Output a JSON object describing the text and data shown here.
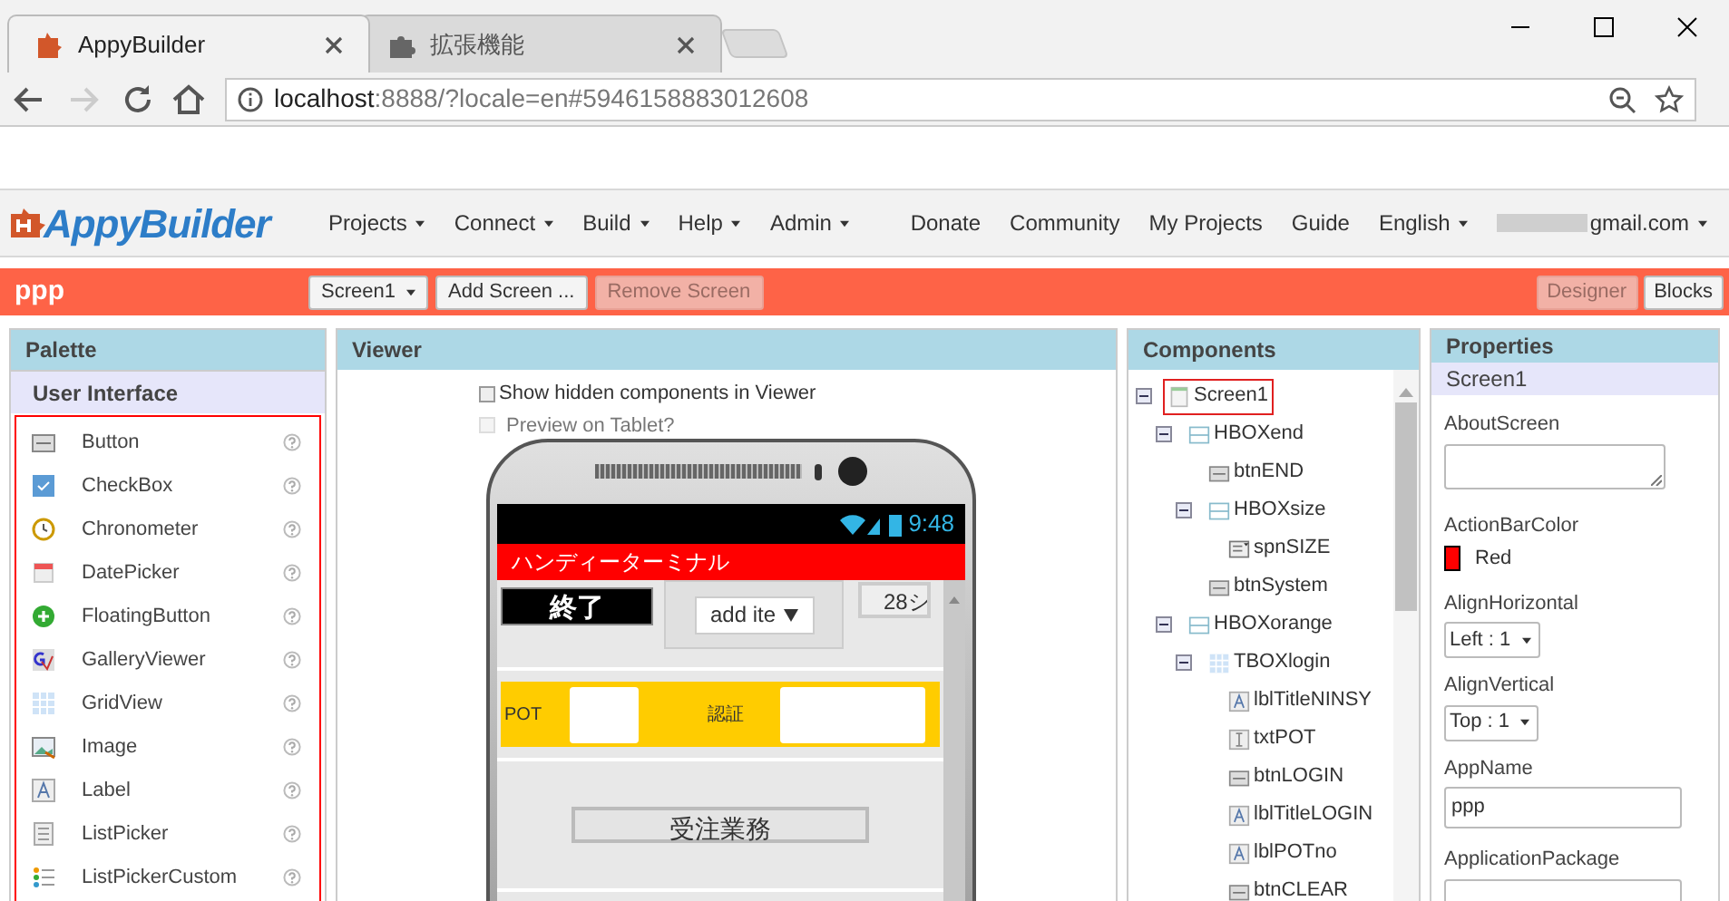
{
  "browser": {
    "tabs": [
      {
        "title": "AppyBuilder",
        "selected": true,
        "kind": "app"
      },
      {
        "title": "拡張機能",
        "selected": false,
        "kind": "puzzle"
      }
    ],
    "url": {
      "host": "localhost",
      "rest": ":8888/?locale=en#5946158883012608"
    }
  },
  "nav": {
    "logo": "AppyBuilder",
    "menus": [
      {
        "label": "Projects",
        "dropdown": true
      },
      {
        "label": "Connect",
        "dropdown": true
      },
      {
        "label": "Build",
        "dropdown": true
      },
      {
        "label": "Help",
        "dropdown": true
      },
      {
        "label": "Admin",
        "dropdown": true
      }
    ],
    "right_menus": [
      {
        "label": "Donate",
        "dropdown": false
      },
      {
        "label": "Community",
        "dropdown": false
      },
      {
        "label": "My Projects",
        "dropdown": false
      },
      {
        "label": "Guide",
        "dropdown": false
      },
      {
        "label": "English",
        "dropdown": true
      },
      {
        "label": "gmail.com",
        "dropdown": true
      }
    ]
  },
  "toolbar": {
    "project": "ppp",
    "buttons": [
      {
        "label": "Screen1",
        "dropdown": true,
        "disabled": false
      },
      {
        "label": "Add Screen ...",
        "dropdown": false,
        "disabled": false
      },
      {
        "label": "Remove Screen",
        "dropdown": false,
        "disabled": true
      }
    ],
    "views": [
      {
        "label": "Designer",
        "selected": true
      },
      {
        "label": "Blocks",
        "selected": false
      }
    ]
  },
  "palette": {
    "title": "Palette",
    "section": "User Interface",
    "items": [
      "Button",
      "CheckBox",
      "Chronometer",
      "DatePicker",
      "FloatingButton",
      "GalleryViewer",
      "GridView",
      "Image",
      "Label",
      "ListPicker",
      "ListPickerCustom"
    ]
  },
  "viewer": {
    "title": "Viewer",
    "options": [
      {
        "label": "Show hidden components in Viewer",
        "checked": false,
        "disabled": false
      },
      {
        "label": "Preview on Tablet?",
        "checked": false,
        "disabled": true
      }
    ],
    "phone": {
      "time": "9:48",
      "title": "ハンディーターミナル",
      "end_button": "終了",
      "spinner": "add ite",
      "cut_button": "28シ",
      "pot_label": "POT",
      "auth_label": "認証",
      "order_button": "受注業務"
    }
  },
  "components": {
    "title": "Components",
    "tree": [
      {
        "name": "Screen1",
        "kind": "screen",
        "selected": true,
        "expanded": true,
        "children": [
          {
            "name": "HBOXend",
            "kind": "hbox",
            "selected": false,
            "expanded": true,
            "children": [
              {
                "name": "btnEND",
                "kind": "button",
                "selected": false
              },
              {
                "name": "HBOXsize",
                "kind": "hbox",
                "selected": false,
                "expanded": true,
                "children": [
                  {
                    "name": "spnSIZE",
                    "kind": "spinner",
                    "selected": false
                  }
                ]
              },
              {
                "name": "btnSystem",
                "kind": "button",
                "selected": false
              }
            ]
          },
          {
            "name": "HBOXorange",
            "kind": "hbox",
            "selected": false,
            "expanded": true,
            "children": [
              {
                "name": "TBOXlogin",
                "kind": "table",
                "selected": false,
                "expanded": true,
                "children": [
                  {
                    "name": "lblTitleNINSY",
                    "kind": "label",
                    "selected": false
                  },
                  {
                    "name": "txtPOT",
                    "kind": "textbox",
                    "selected": false
                  },
                  {
                    "name": "btnLOGIN",
                    "kind": "button",
                    "selected": false
                  },
                  {
                    "name": "lblTitleLOGIN",
                    "kind": "label",
                    "selected": false
                  },
                  {
                    "name": "lblPOTno",
                    "kind": "label",
                    "selected": false
                  },
                  {
                    "name": "btnCLEAR",
                    "kind": "button",
                    "selected": false
                  }
                ]
              }
            ]
          }
        ]
      }
    ]
  },
  "properties": {
    "title": "Properties",
    "component": "Screen1",
    "items": [
      {
        "label": "AboutScreen",
        "kind": "textarea"
      },
      {
        "label": "ActionBarColor",
        "kind": "color",
        "value": "Red",
        "color": "#ff0000"
      },
      {
        "label": "AlignHorizontal",
        "kind": "dropdown",
        "value": "Left : 1"
      },
      {
        "label": "AlignVertical",
        "kind": "dropdown",
        "value": "Top : 1"
      },
      {
        "label": "AppName",
        "kind": "text",
        "value": "ppp"
      },
      {
        "label": "ApplicationPackage",
        "kind": "text"
      }
    ]
  }
}
